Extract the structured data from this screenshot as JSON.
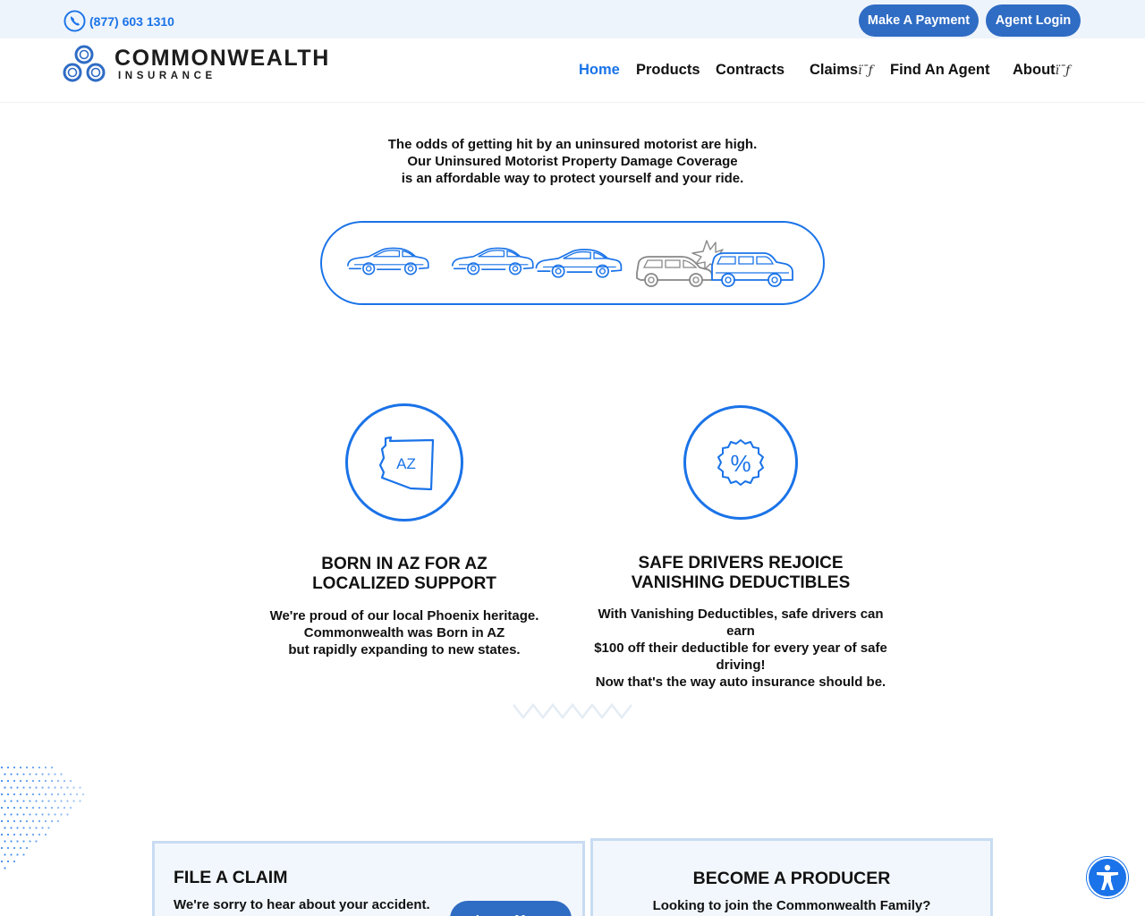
{
  "topbar": {
    "phone": "(877) 603 1310",
    "make_payment": "Make A Payment",
    "agent_login": "Agent Login"
  },
  "logo": {
    "name": "COMMONWEALTH",
    "sub": "INSURANCE"
  },
  "nav": {
    "home": "Home",
    "products": "Products",
    "contracts": "Contracts",
    "claims": "Claims",
    "find_agent": "Find An Agent",
    "about": "About",
    "dropdown_glyph": "ï¯ƒ"
  },
  "intro": {
    "line1": "The odds of getting hit by an uninsured motorist are high.",
    "line2": "Our Uninsured Motorist Property Damage Coverage",
    "line3": "is an affordable way to protect yourself and your ride."
  },
  "features": [
    {
      "icon_text": "AZ",
      "title_line1": "BORN IN AZ FOR AZ",
      "title_line2": "LOCALIZED SUPPORT",
      "body_line1": "We're proud of our local Phoenix heritage.",
      "body_line2": "Commonwealth was Born in AZ",
      "body_line3": "but rapidly expanding to new states."
    },
    {
      "icon_text": "%",
      "title_line1": "SAFE DRIVERS REJOICE",
      "title_line2": "VANISHING DEDUCTIBLES",
      "body_line1": "With Vanishing Deductibles, safe drivers can earn",
      "body_line2": "$100 off their deductible for every year of safe driving!",
      "body_line3": "Now that's the way auto insurance should be."
    }
  ],
  "cards": {
    "claim": {
      "title": "FILE A CLAIM",
      "text": "We're sorry to hear about your accident.",
      "button": "Learn More"
    },
    "producer": {
      "title": "BECOME A PRODUCER",
      "text": "Looking to join the Commonwealth Family?"
    }
  },
  "colors": {
    "accent": "#1a73e8",
    "button": "#2f6cc4",
    "topbar_bg": "#eef4fb",
    "card_bg": "#f2f7fd"
  }
}
